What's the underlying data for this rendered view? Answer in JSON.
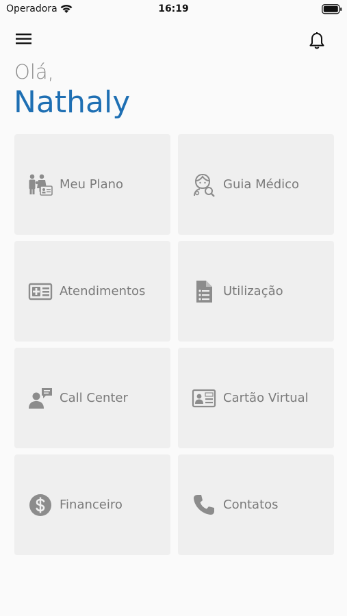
{
  "status_bar": {
    "carrier": "Operadora",
    "time": "16:19"
  },
  "header": {
    "greeting": "Olá,",
    "user_name": "Nathaly"
  },
  "tiles": [
    {
      "label": "Meu Plano",
      "icon": "family-plan-icon"
    },
    {
      "label": "Guia Médico",
      "icon": "doctor-search-icon"
    },
    {
      "label": "Atendimentos",
      "icon": "medical-card-icon"
    },
    {
      "label": "Utilização",
      "icon": "document-list-icon"
    },
    {
      "label": "Call Center",
      "icon": "call-center-icon"
    },
    {
      "label": "Cartão Virtual",
      "icon": "virtual-card-icon"
    },
    {
      "label": "Financeiro",
      "icon": "dollar-icon"
    },
    {
      "label": "Contatos",
      "icon": "phone-icon"
    }
  ],
  "colors": {
    "accent": "#1e6fb3",
    "tile_bg": "#efefef",
    "icon": "#8c8c8c"
  }
}
